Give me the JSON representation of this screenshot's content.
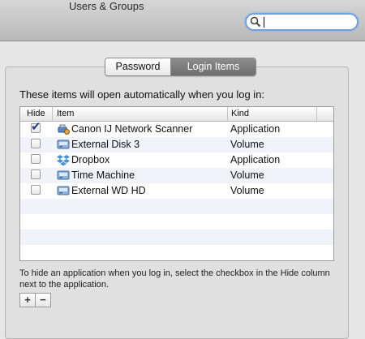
{
  "window": {
    "title": "Users & Groups"
  },
  "search": {
    "placeholder": "",
    "value": ""
  },
  "tabs": [
    {
      "label": "Password",
      "selected": false
    },
    {
      "label": "Login Items",
      "selected": true
    }
  ],
  "intro_text": "These items will open automatically when you log in:",
  "table": {
    "columns": [
      "Hide",
      "Item",
      "Kind"
    ],
    "rows": [
      {
        "hide": true,
        "icon": "scanner-app-icon",
        "name": "Canon IJ Network Scanner",
        "kind": "Application"
      },
      {
        "hide": false,
        "icon": "disk-volume-icon",
        "name": "External Disk 3",
        "kind": "Volume"
      },
      {
        "hide": false,
        "icon": "dropbox-icon",
        "name": "Dropbox",
        "kind": "Application"
      },
      {
        "hide": false,
        "icon": "disk-volume-icon",
        "name": "Time Machine",
        "kind": "Volume"
      },
      {
        "hide": false,
        "icon": "disk-volume-icon",
        "name": "External WD HD",
        "kind": "Volume"
      }
    ]
  },
  "help_text": "To hide an application when you log in, select the checkbox in the Hide column next to the application.",
  "buttons": {
    "add": "+",
    "remove": "−"
  },
  "colors": {
    "accent": "#6fa0e0",
    "selected_tab": "#7d7d7d",
    "alt_row": "#f0f4fa"
  }
}
